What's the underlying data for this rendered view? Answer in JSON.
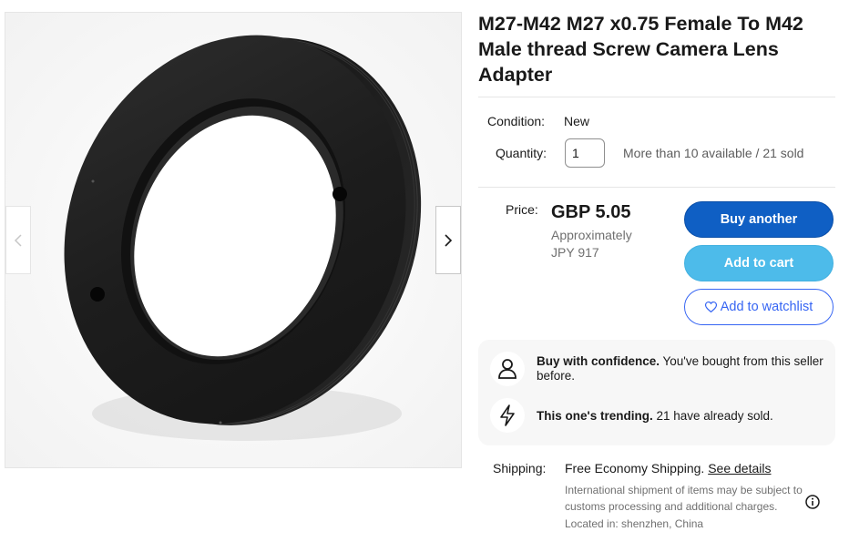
{
  "product": {
    "title": "M27-M42 M27 x0.75 Female To M42 Male thread Screw Camera Lens Adapter"
  },
  "condition": {
    "label": "Condition:",
    "value": "New"
  },
  "quantity": {
    "label": "Quantity:",
    "value": "1",
    "availability": "More than 10 available / 21 sold"
  },
  "price": {
    "label": "Price:",
    "value": "GBP 5.05",
    "approx_label": "Approximately",
    "approx_value": "JPY 917"
  },
  "buttons": {
    "buy": "Buy another",
    "cart": "Add to cart",
    "watchlist": "Add to watchlist"
  },
  "signals": [
    {
      "icon": "person-icon",
      "bold": "Buy with confidence.",
      "text": " You've bought from this seller before."
    },
    {
      "icon": "lightning-icon",
      "bold": "This one's trending.",
      "text": " 21 have already sold."
    }
  ],
  "shipping": {
    "label": "Shipping:",
    "value": "Free Economy Shipping.",
    "link": "See details",
    "note": "International shipment of items may be subject to customs processing and additional charges.",
    "location": "Located in: shenzhen, China"
  },
  "colors": {
    "buy_button": "#0f5fc4",
    "cart_button": "#4dbbea",
    "link_blue": "#3665f3"
  }
}
